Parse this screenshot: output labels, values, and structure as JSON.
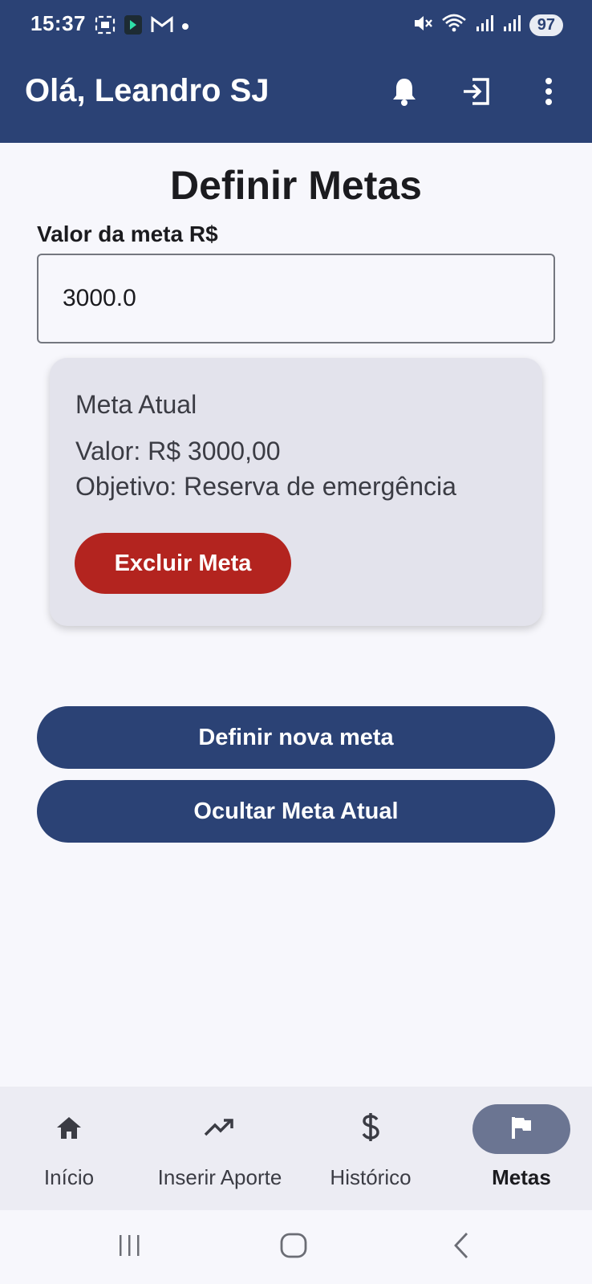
{
  "status_bar": {
    "time": "15:37",
    "left_icons": [
      "screenshot-icon",
      "app-icon",
      "gmail-icon",
      "dot-icon"
    ],
    "right_icons": [
      "mute-icon",
      "wifi-icon",
      "signal-icon",
      "signal-icon"
    ],
    "battery": "97"
  },
  "app_bar": {
    "title": "Olá, Leandro SJ",
    "actions": [
      "bell-icon",
      "logout-icon",
      "more-vert-icon"
    ]
  },
  "page": {
    "title": "Definir Metas",
    "goal_field": {
      "label": "Valor da meta R$",
      "value": "3000.0"
    }
  },
  "current_goal_card": {
    "title": "Meta Atual",
    "value_line": "Valor: R$ 3000,00",
    "objective_line": "Objetivo: Reserva de emergência",
    "delete_label": "Excluir Meta",
    "delete_color": "#b3241f"
  },
  "buttons": {
    "new_goal": "Definir nova meta",
    "hide_goal": "Ocultar Meta Atual"
  },
  "bottom_nav": {
    "items": [
      {
        "label": "Início",
        "icon": "home-icon",
        "active": false
      },
      {
        "label": "Inserir Aporte",
        "icon": "trending-up-icon",
        "active": false
      },
      {
        "label": "Histórico",
        "icon": "dollar-icon",
        "active": false
      },
      {
        "label": "Metas",
        "icon": "flag-icon",
        "active": true
      }
    ]
  },
  "system_nav": [
    "recents-icon",
    "home-circle-icon",
    "back-icon"
  ],
  "colors": {
    "primary": "#2b4275",
    "background": "#f7f7fc",
    "card": "#e3e3ec",
    "danger": "#b3241f",
    "nav_indicator": "#6b7592"
  }
}
